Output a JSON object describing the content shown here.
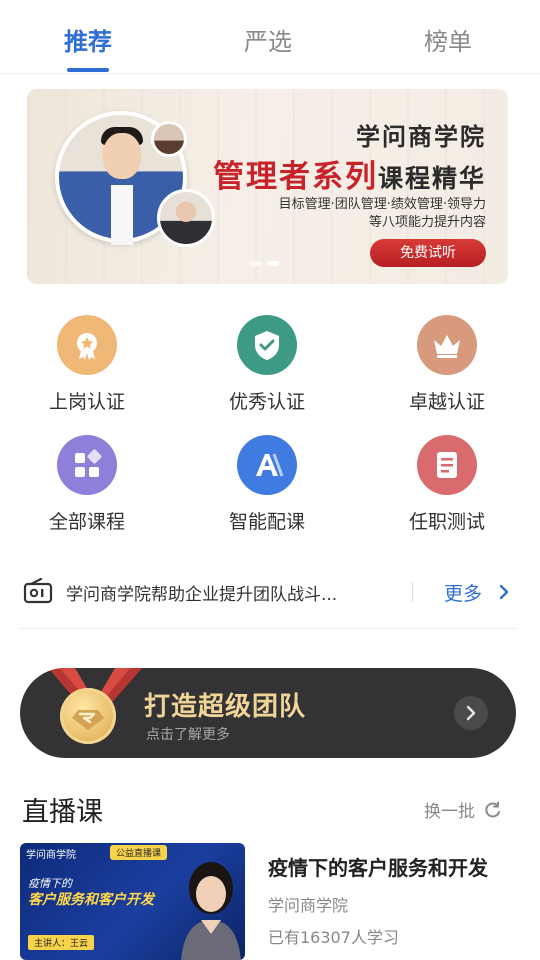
{
  "tabs": [
    {
      "label": "推荐",
      "active": true
    },
    {
      "label": "严选",
      "active": false
    },
    {
      "label": "榜单",
      "active": false
    }
  ],
  "banner": {
    "title": "学问商学院",
    "subtitle_highlight": "管理者系列",
    "subtitle_rest": "课程精华",
    "desc_line1": "目标管理·团队管理·绩效管理·领导力",
    "desc_line2": "等八项能力提升内容",
    "button_label": "免费试听",
    "slide_count": 2,
    "active_slide": 2
  },
  "grid": [
    {
      "label": "上岗认证",
      "icon": "badge-icon",
      "color": "#f0b877"
    },
    {
      "label": "优秀认证",
      "icon": "shield-check-icon",
      "color": "#3d9b85"
    },
    {
      "label": "卓越认证",
      "icon": "crown-icon",
      "color": "#d79a7d"
    },
    {
      "label": "全部课程",
      "icon": "grid-icon",
      "color": "#8f7fd8"
    },
    {
      "label": "智能配课",
      "icon": "ai-icon",
      "color": "#3f7be0"
    },
    {
      "label": "任职测试",
      "icon": "document-icon",
      "color": "#d96a6d"
    }
  ],
  "notice": {
    "icon": "radio-icon",
    "text": "学问商学院帮助企业提升团队战斗...",
    "more_label": "更多"
  },
  "team_banner": {
    "title": "打造超级团队",
    "subtitle": "点击了解更多"
  },
  "live": {
    "section_title": "直播课",
    "refresh_label": "换一批",
    "course": {
      "thumb_org": "学问商学院",
      "thumb_badge": "公益直播课",
      "thumb_line1": "疫情下的",
      "thumb_line2": "客户服务和客户开发",
      "thumb_speaker": "主讲人：王云",
      "title": "疫情下的客户服务和开发",
      "org": "学问商学院",
      "learners": "已有16307人学习"
    }
  },
  "colors": {
    "accent": "#2f6fd6",
    "banner_red": "#c8232b",
    "team_bg": "#333335",
    "team_gold": "#f0d597"
  }
}
